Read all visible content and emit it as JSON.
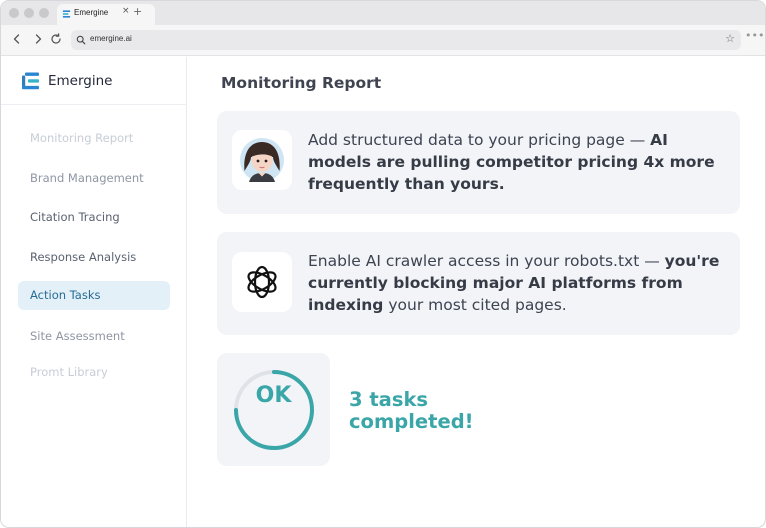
{
  "browser": {
    "tab_title": "Emergine",
    "tab_close": "×",
    "new_tab": "+",
    "url": "emergine.ai",
    "more": "•••"
  },
  "sidebar": {
    "brand": "Emergine",
    "items": [
      {
        "label": "Monitoring Report"
      },
      {
        "label": "Brand Management"
      },
      {
        "label": "Citation Tracing"
      },
      {
        "label": "Response Analysis"
      },
      {
        "label": "Action Tasks"
      },
      {
        "label": "Site Assessment"
      },
      {
        "label": "Promt Library"
      }
    ],
    "active_item": "Action Tasks"
  },
  "main": {
    "title": "Monitoring Report",
    "cards": [
      {
        "icon": "avatar-icon",
        "text_plain": "Add structured data to your pricing page — ",
        "text_bold": "AI models are pulling competitor pricing 4x more frequently than yours.",
        "text_tail": ""
      },
      {
        "icon": "openai-logo-icon",
        "text_plain": "Enable AI crawler access in your robots.txt — ",
        "text_bold": "you're currently blocking major AI platforms from indexing",
        "text_tail": " your most cited pages."
      }
    ],
    "status": {
      "badge": "OK",
      "message": "3 tasks completed!"
    }
  },
  "colors": {
    "accent": "#3aa6a8",
    "active_nav_bg": "#e4f0f7",
    "active_nav_text": "#256c95",
    "card_bg": "#f2f4f8",
    "brand_blue": "#2a86d1"
  }
}
